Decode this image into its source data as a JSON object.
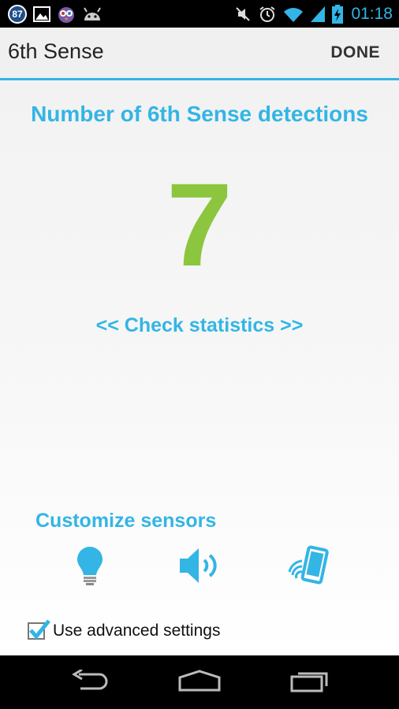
{
  "status_bar": {
    "notification_badge": "87",
    "time": "01:18",
    "icons": [
      "picture-icon",
      "owl-app-icon",
      "android-icon",
      "mute-icon",
      "alarm-icon",
      "wifi-icon",
      "signal-icon",
      "battery-charging-icon"
    ]
  },
  "action_bar": {
    "title": "6th Sense",
    "done_label": "DONE"
  },
  "main": {
    "heading": "Number of 6th Sense detections",
    "detection_count": "7",
    "stats_link": "<< Check statistics >>",
    "customize_heading": "Customize sensors",
    "sensors": [
      "light-bulb-icon",
      "speaker-icon",
      "phone-vibrate-icon"
    ],
    "advanced_checkbox_checked": true,
    "advanced_label": "Use advanced settings"
  },
  "nav_bar": {
    "buttons": [
      "back-icon",
      "home-icon",
      "recents-icon"
    ]
  },
  "colors": {
    "accent": "#33b5e5",
    "count_green": "#8cc63f"
  }
}
